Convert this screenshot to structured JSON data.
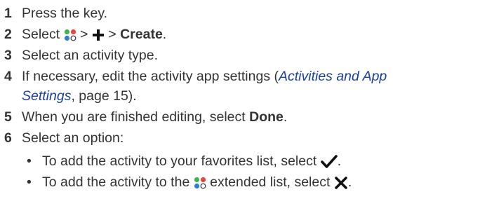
{
  "steps": [
    {
      "num": "1",
      "text": "Press the key."
    },
    {
      "num": "2",
      "pre": "Select",
      "sep1": ">",
      "sep2": ">",
      "bold": "Create",
      "post": "."
    },
    {
      "num": "3",
      "text": "Select an activity type."
    },
    {
      "num": "4",
      "line1_pre": "If necessary, edit the activity app settings (",
      "link1": "Activities and App",
      "link2": "Settings",
      "line2_post": ", page 15)."
    },
    {
      "num": "5",
      "pre": "When you are finished editing, select ",
      "bold": "Done",
      "post": "."
    },
    {
      "num": "6",
      "text": "Select an option:"
    }
  ],
  "bullets": [
    {
      "mark": "•",
      "pre": "To add the activity to your favorites list, select",
      "post": "."
    },
    {
      "mark": "•",
      "pre": "To add the activity to the",
      "mid": "extended list, select",
      "post": "."
    }
  ],
  "icons": {
    "apps": "apps-icon",
    "plus": "plus-icon",
    "check": "checkmark-icon",
    "close": "x-icon"
  },
  "colors": {
    "text": "#333333",
    "link": "#1b3f9f",
    "apps_green": "#3fb44a",
    "apps_red": "#e8453c",
    "apps_blue": "#2f7fd1",
    "apps_yellow": "#f0b41c"
  }
}
